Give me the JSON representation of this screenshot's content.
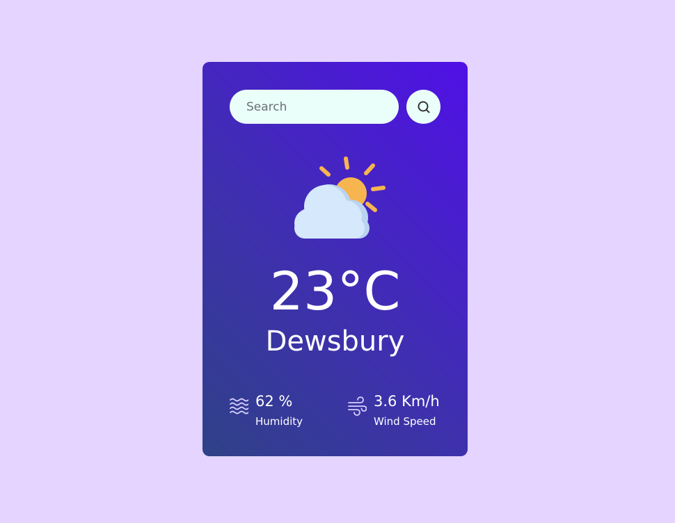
{
  "search": {
    "placeholder": "Search"
  },
  "weather": {
    "icon": "partly-cloudy-icon",
    "temperature": "23°C",
    "city": "Dewsbury"
  },
  "details": {
    "humidity": {
      "value": "62 %",
      "label": "Humidity",
      "icon": "humidity-icon"
    },
    "wind": {
      "value": "3.6 Km/h",
      "label": "Wind Speed",
      "icon": "wind-icon"
    }
  },
  "colors": {
    "page_background": "#e4d4ff",
    "card_gradient_start": "#2f4187",
    "card_gradient_end": "#5010e6",
    "input_background": "#eafff9",
    "sun": "#f7b54f",
    "cloud": "#d6e8fb"
  }
}
